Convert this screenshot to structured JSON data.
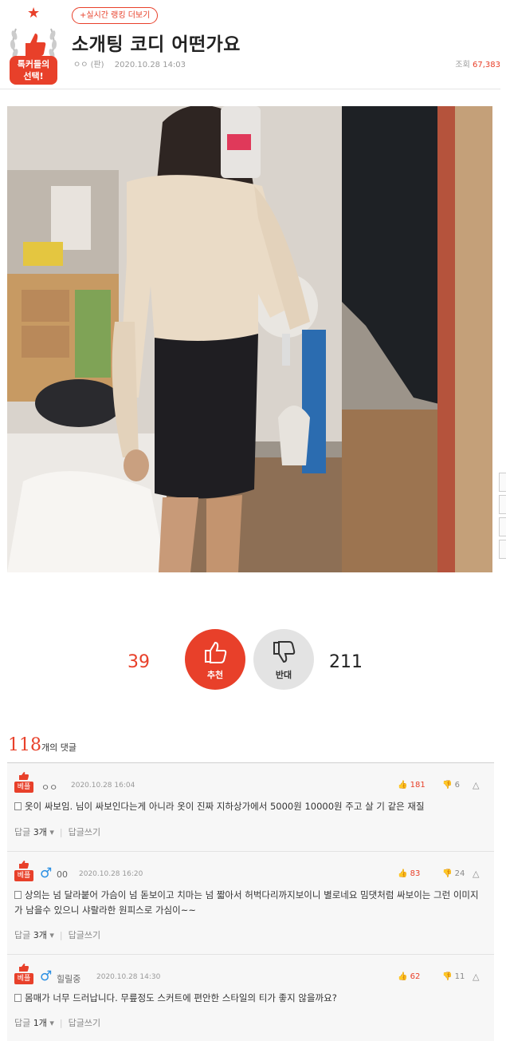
{
  "badge": {
    "line1": "톡커들의",
    "line2": "선택!"
  },
  "header": {
    "ranking_link": "+실시간 랭킹 더보기",
    "title": "소개팅 코디 어떤가요",
    "author": "ㅇㅇ (판)",
    "date": "2020.10.28 14:03",
    "views_label": "조회",
    "views_count": "67,383"
  },
  "votes": {
    "up_count": "39",
    "up_label": "추천",
    "down_label": "반대",
    "down_count": "211"
  },
  "comments_header": {
    "count": "118",
    "suffix": "개의 댓글"
  },
  "comments": [
    {
      "best_tag": "베플",
      "author": "ㅇㅇ",
      "date": "2020.10.28 16:04",
      "up": "181",
      "down": "6",
      "text": "옷이 싸보임. 님이 싸보인다는게 아니라 옷이 진짜 지하상가에서 5000원 10000원 주고 살 기 같은 재질",
      "reply_label": "답글",
      "reply_count": "3개",
      "write_reply": "답글쓰기"
    },
    {
      "best_tag": "베플",
      "author": "00",
      "date": "2020.10.28 16:20",
      "up": "83",
      "down": "24",
      "text": "상의는 넘 달라붙어 가슴이 넘 돋보이고 치마는 넘 짧아서 허벅다리까지보이니 별로네요 밈댓처럼 싸보이는 그런 이미지가 남을수 있으니 샤랄라한 원피스로 가심이~~",
      "reply_label": "답글",
      "reply_count": "3개",
      "write_reply": "답글쓰기"
    },
    {
      "best_tag": "베플",
      "author": "힐릴중",
      "date": "2020.10.28 14:30",
      "up": "62",
      "down": "11",
      "text": "몸매가 너무 드러납니다. 무릎정도 스커트에 편안한 스타일의 티가 좋지 않을까요?",
      "reply_label": "답글",
      "reply_count": "1개",
      "write_reply": "답글쓰기"
    }
  ],
  "colors": {
    "accent": "#e8402a",
    "male": "#2a8fe3",
    "comment_bg": "#f7f7f7"
  },
  "icons": {
    "badge": "thumbs-up-laurel-icon",
    "vote_up": "thumbs-up-icon",
    "vote_down": "thumbs-down-icon",
    "gender": "male-icon",
    "report": "siren-icon",
    "text_marker": "document-icon"
  }
}
